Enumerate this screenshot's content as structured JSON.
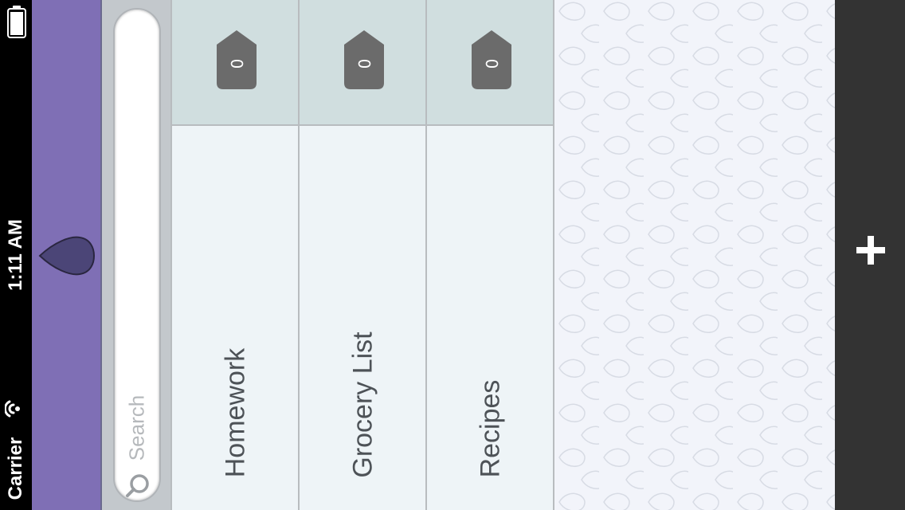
{
  "status_bar": {
    "time": "1:11 AM",
    "carrier": "Carrier",
    "battery_icon": "battery-icon",
    "wifi_icon": "wifi-icon"
  },
  "app_bar": {
    "logo_icon": "drop-icon",
    "color": "#7f6fb5"
  },
  "search": {
    "placeholder": "Search",
    "icon": "search-icon"
  },
  "lists": [
    {
      "title": "Homework",
      "count": "0"
    },
    {
      "title": "Grocery List",
      "count": "0"
    },
    {
      "title": "Recipes",
      "count": "0"
    }
  ],
  "toolbar": {
    "add_icon": "plus-icon"
  },
  "colors": {
    "accent_purple": "#7f6fb5",
    "tag_gray": "#6b6b6b",
    "header_bg": "#d0dedf",
    "list_bg": "#eef4f7",
    "dark_bar": "#333333"
  }
}
